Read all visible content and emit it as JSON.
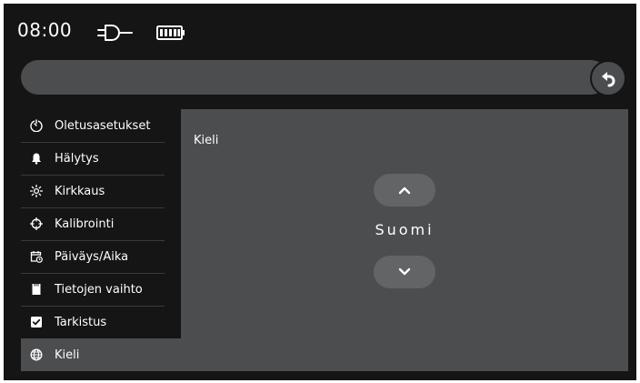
{
  "status_bar": {
    "time": "08:00",
    "icons": [
      "plug-icon",
      "battery-icon"
    ]
  },
  "breadcrumb": {
    "text": ""
  },
  "back_button": {
    "icon": "back-arrow-icon"
  },
  "sidebar": {
    "items": [
      {
        "label": "Oletusasetukset",
        "icon": "timer-icon"
      },
      {
        "label": "Hälytys",
        "icon": "bell-icon"
      },
      {
        "label": "Kirkkaus",
        "icon": "sun-icon"
      },
      {
        "label": "Kalibrointi",
        "icon": "crosshair-icon"
      },
      {
        "label": "Päiväys/Aika",
        "icon": "calendar-clock-icon"
      },
      {
        "label": "Tietojen vaihto",
        "icon": "sd-card-icon"
      },
      {
        "label": "Tarkistus",
        "icon": "checkbox-icon"
      },
      {
        "label": "Kieli",
        "icon": "globe-icon",
        "active": true
      }
    ]
  },
  "panel": {
    "title": "Kieli",
    "value": "Suomi",
    "up_icon": "chevron-up-icon",
    "down_icon": "chevron-down-icon"
  },
  "colors": {
    "background": "#151515",
    "surface": "#4b4d4e",
    "button": "#626465",
    "text": "#ffffff"
  }
}
